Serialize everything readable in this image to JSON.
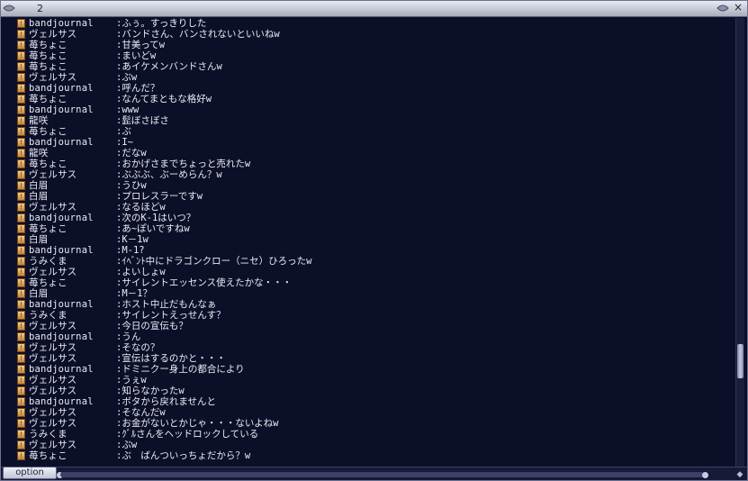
{
  "window": {
    "title": "2",
    "close_glyph": "×"
  },
  "chat": {
    "job_icon_glyph": "!",
    "lines": [
      {
        "name": "bandjournal",
        "msg": ":ふぅ。すっきりした"
      },
      {
        "name": "ヴェルサス",
        "msg": ":バンドさん、バンされないといいねw"
      },
      {
        "name": "苺ちょこ",
        "msg": ":甘美ってw"
      },
      {
        "name": "苺ちょこ",
        "msg": ":まいどw"
      },
      {
        "name": "苺ちょこ",
        "msg": ":あイケメンバンドさんw"
      },
      {
        "name": "ヴェルサス",
        "msg": ":ぶw"
      },
      {
        "name": "bandjournal",
        "msg": ":呼んだ？"
      },
      {
        "name": "苺ちょこ",
        "msg": ":なんてまともな格好w"
      },
      {
        "name": "bandjournal",
        "msg": ":www"
      },
      {
        "name": "龍咲",
        "msg": ":髭ぼさぼさ"
      },
      {
        "name": "苺ちょこ",
        "msg": ":ぶ"
      },
      {
        "name": "bandjournal",
        "msg": ":I~"
      },
      {
        "name": "龍咲",
        "msg": ":だなw"
      },
      {
        "name": "苺ちょこ",
        "msg": ":おかげさまでちょっと売れたw"
      },
      {
        "name": "ヴェルサス",
        "msg": ":ぶぶぶ、ぶーめらん？w"
      },
      {
        "name": "白眉",
        "msg": ":うひw"
      },
      {
        "name": "白眉",
        "msg": ":プロレスラーですw"
      },
      {
        "name": "ヴェルサス",
        "msg": ":なるほどw"
      },
      {
        "name": "bandjournal",
        "msg": ":次のK-1はいつ？"
      },
      {
        "name": "苺ちょこ",
        "msg": ":あ~ぽいですねw"
      },
      {
        "name": "白眉",
        "msg": ":K－1w"
      },
      {
        "name": "bandjournal",
        "msg": ":M-1?"
      },
      {
        "name": "うみくま",
        "msg": ":ｲﾍﾞﾝﾄ中にドラゴンクロー（ニセ）ひろったw"
      },
      {
        "name": "ヴェルサス",
        "msg": ":よいしょw"
      },
      {
        "name": "苺ちょこ",
        "msg": ":サイレントエッセンス使えたかな・・・"
      },
      {
        "name": "白眉",
        "msg": ":M－1？"
      },
      {
        "name": "bandjournal",
        "msg": ":ホスト中止だもんなぁ"
      },
      {
        "name": "うみくま",
        "msg": ":サイレントえっせんす？"
      },
      {
        "name": "ヴェルサス",
        "msg": ":今日の宣伝も？"
      },
      {
        "name": "bandjournal",
        "msg": ":うん"
      },
      {
        "name": "ヴェルサス",
        "msg": ":そなの？"
      },
      {
        "name": "ヴェルサス",
        "msg": ":宣伝はするのかと・・・"
      },
      {
        "name": "bandjournal",
        "msg": ":ドミニクー身上の都合により"
      },
      {
        "name": "ヴェルサス",
        "msg": ":うぇw"
      },
      {
        "name": "ヴェルサス",
        "msg": ":知らなかったw"
      },
      {
        "name": "bandjournal",
        "msg": ":ボタから戻れませんと"
      },
      {
        "name": "ヴェルサス",
        "msg": ":そなんだw"
      },
      {
        "name": "ヴェルサス",
        "msg": ":お金がないとかじゃ・・・ないよねw"
      },
      {
        "name": "うみくま",
        "msg": ":ｸﾞﾙさんをヘッドロックしている"
      },
      {
        "name": "ヴェルサス",
        "msg": ":ぶw"
      },
      {
        "name": "苺ちょこ",
        "msg": ":ぶ　ばんついっちょだから？w"
      }
    ]
  },
  "scrollbar": {
    "position_fraction": 0.95
  },
  "bottom": {
    "option_label": "option",
    "corner_glyph": "◆"
  },
  "colors": {
    "background": "#0c0f28",
    "text": "#e9ecf4",
    "titlebar": "#c6c8d4"
  }
}
